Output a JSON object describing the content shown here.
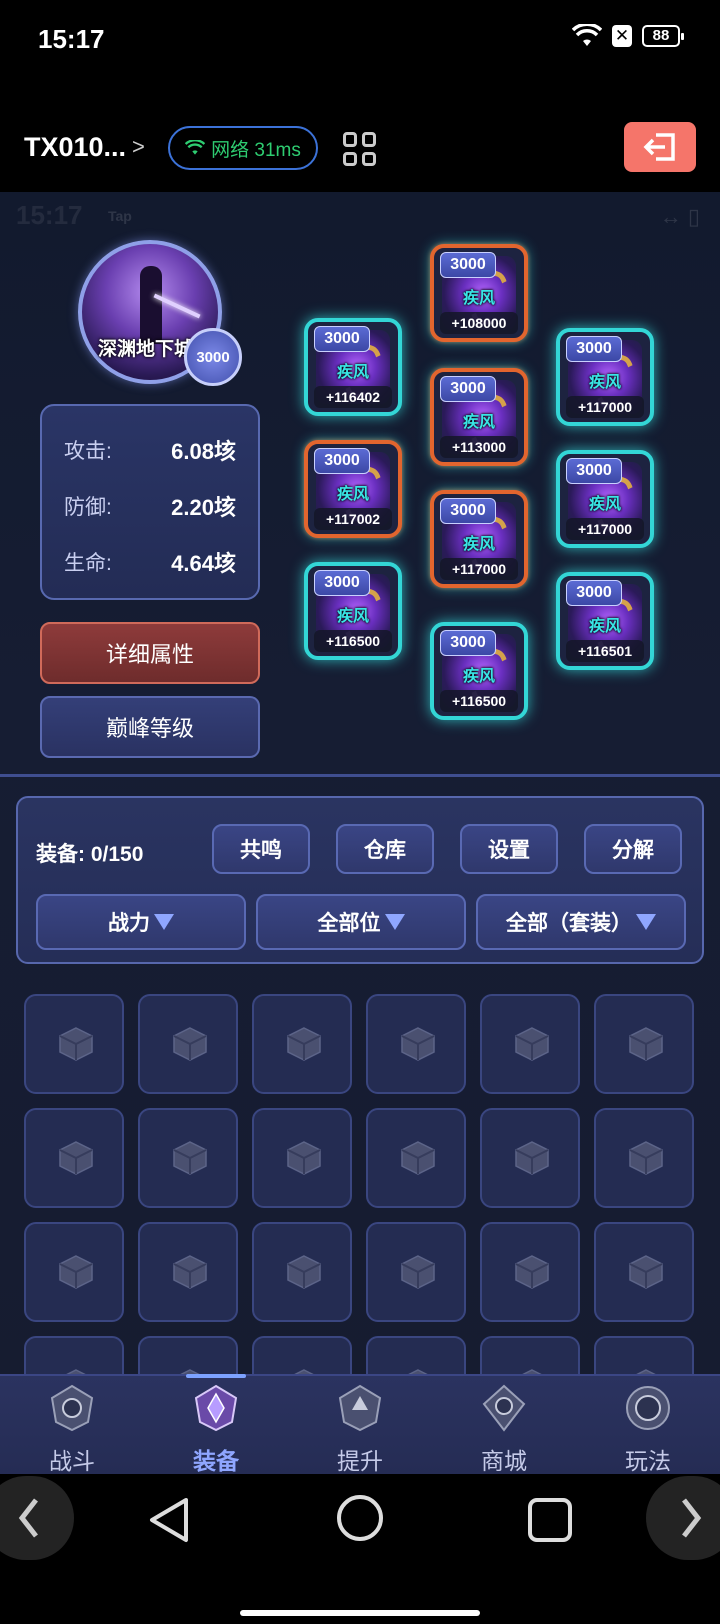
{
  "status_bar": {
    "time": "15:17",
    "battery": "88"
  },
  "title_bar": {
    "title": "TX010...",
    "network": "网络 31ms"
  },
  "ghost_overlay": {
    "time": "15:17",
    "tap": "Tap"
  },
  "profile": {
    "name": "深渊地下城",
    "level": "3000"
  },
  "stats": [
    {
      "label": "攻击:",
      "value": "6.08垓"
    },
    {
      "label": "防御:",
      "value": "2.20垓"
    },
    {
      "label": "生命:",
      "value": "4.64垓"
    }
  ],
  "buttons": {
    "detail": "详细属性",
    "peak": "巅峰等级"
  },
  "equipment": [
    {
      "level": "3000",
      "set": "疾风",
      "bonus": "+116402",
      "frame": "cyan"
    },
    {
      "level": "3000",
      "set": "疾风",
      "bonus": "+108000",
      "frame": "orange"
    },
    {
      "level": "3000",
      "set": "疾风",
      "bonus": "+117000",
      "frame": "cyan"
    },
    {
      "level": "3000",
      "set": "疾风",
      "bonus": "+117002",
      "frame": "orange"
    },
    {
      "level": "3000",
      "set": "疾风",
      "bonus": "+113000",
      "frame": "orange"
    },
    {
      "level": "3000",
      "set": "疾风",
      "bonus": "+117000",
      "frame": "cyan"
    },
    {
      "level": "3000",
      "set": "疾风",
      "bonus": "+116500",
      "frame": "cyan"
    },
    {
      "level": "3000",
      "set": "疾风",
      "bonus": "+117000",
      "frame": "orange"
    },
    {
      "level": "3000",
      "set": "疾风",
      "bonus": "+116501",
      "frame": "cyan"
    },
    {
      "level": "3000",
      "set": "疾风",
      "bonus": "+116500",
      "frame": "cyan"
    }
  ],
  "inventory": {
    "count_label": "装备: 0/150",
    "actions": [
      "共鸣",
      "仓库",
      "设置",
      "分解"
    ],
    "filters": [
      "战力",
      "全部位",
      "全部（套装）"
    ]
  },
  "bottom_nav": [
    {
      "label": "战斗",
      "active": false
    },
    {
      "label": "装备",
      "active": true
    },
    {
      "label": "提升",
      "active": false
    },
    {
      "label": "商城",
      "active": false
    },
    {
      "label": "玩法",
      "active": false
    }
  ],
  "colors": {
    "accent": "#8fa6ff",
    "cyan_frame": "#33d6d6",
    "orange_frame": "#e2652e",
    "exit_button": "#f5756a",
    "network_text": "#2ecc71"
  }
}
